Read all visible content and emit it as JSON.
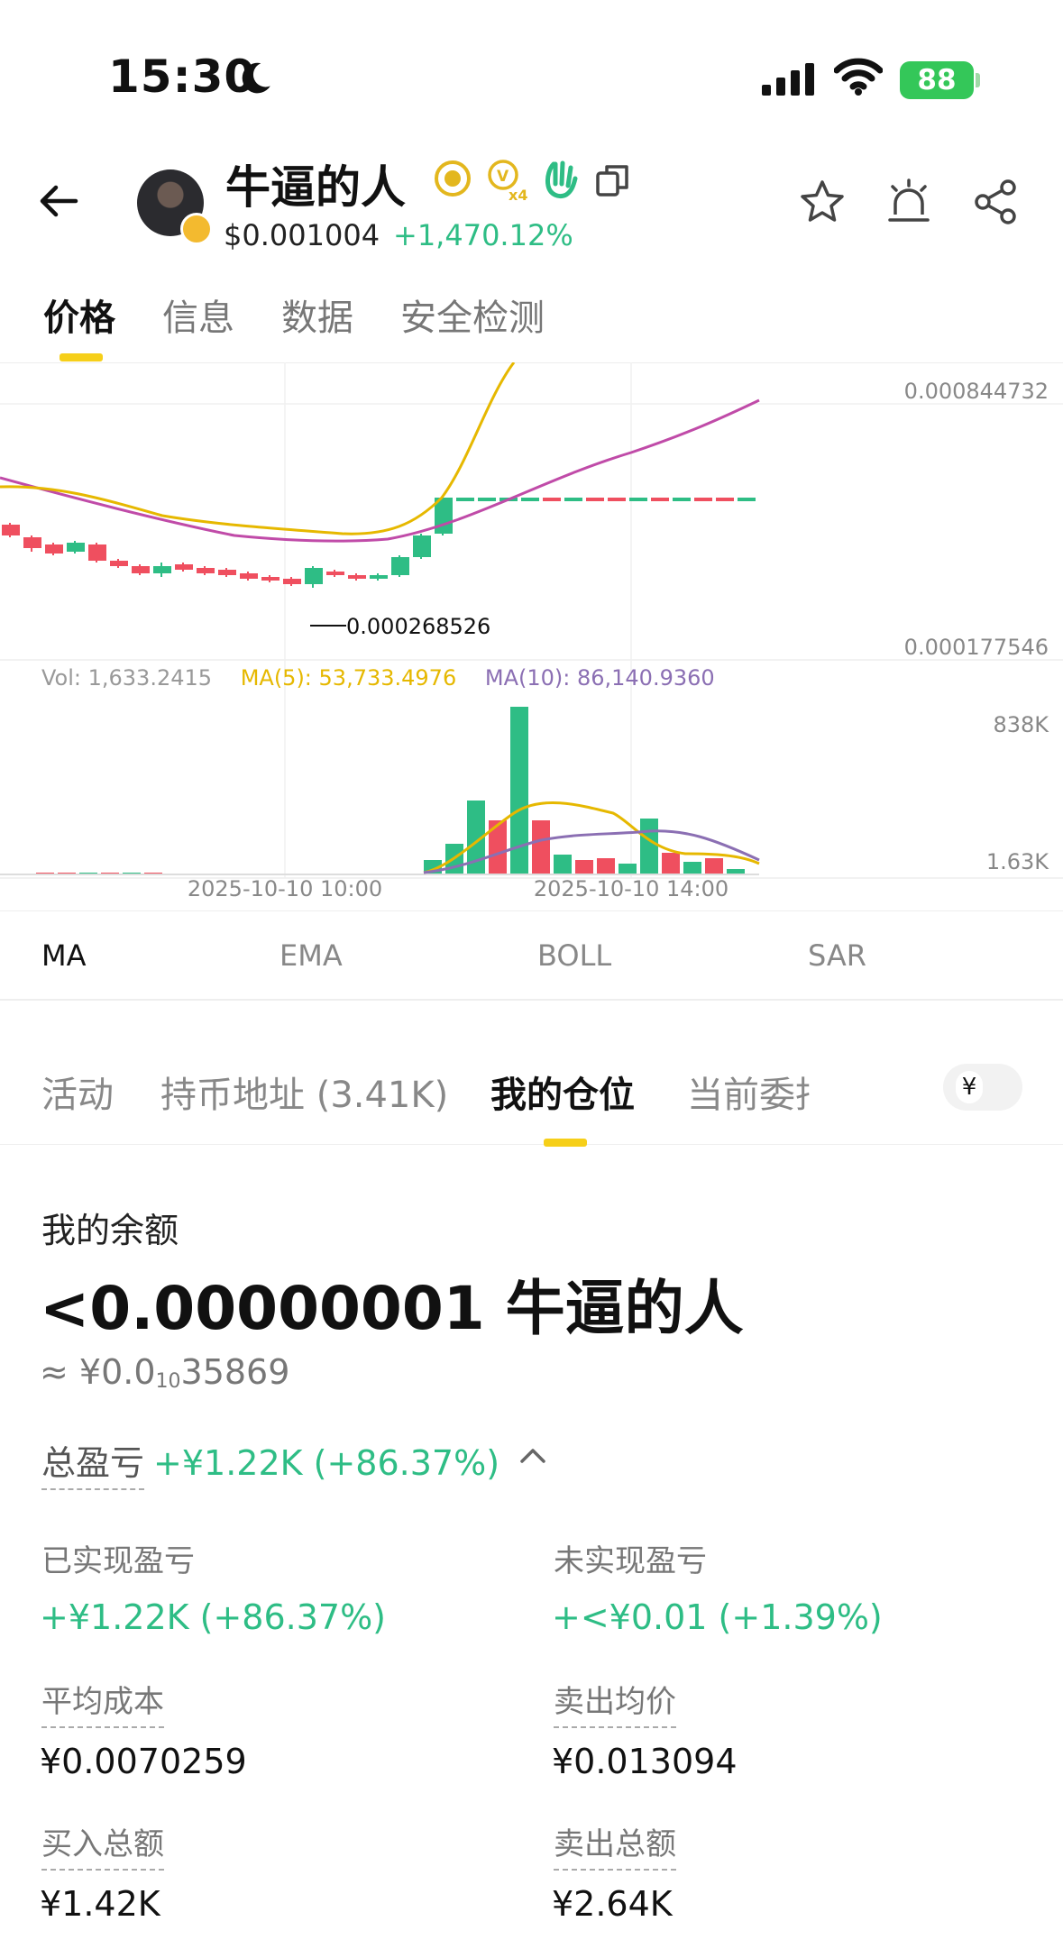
{
  "status_bar": {
    "time": "15:30",
    "battery": "88"
  },
  "header": {
    "token_name": "牛逼的人",
    "price": "$0.001004",
    "change": "+1,470.12%"
  },
  "tabs": [
    "价格",
    "信息",
    "数据",
    "安全检测"
  ],
  "chart": {
    "price_high_label": "0.000844732",
    "price_low_label": "0.000177546",
    "marker_label": "0.000268526",
    "vol_max_label": "838K",
    "vol_min_label": "1.63K",
    "x_labels": [
      "2025-10-10 10:00",
      "2025-10-10 14:00"
    ],
    "legend": {
      "vol": "Vol: 1,633.2415",
      "ma5": "MA(5): 53,733.4976",
      "ma10": "MA(10): 86,140.9360"
    },
    "colors": {
      "up": "#2ebd85",
      "down": "#ef4f5f",
      "ma_yellow": "#e6b800",
      "ma_purple": "#c04ba8",
      "vol_purple": "#8b6fb3"
    }
  },
  "indicators": [
    "MA",
    "EMA",
    "BOLL",
    "SAR"
  ],
  "subtabs": [
    "活动",
    "持币地址 (3.41K)",
    "我的仓位",
    "当前委托"
  ],
  "currency_symbol": "¥",
  "position": {
    "balance_label": "我的余额",
    "balance": "<0.00000001 牛逼的人",
    "balance_cny_prefix": "≈ ¥0.0",
    "balance_cny_sub": "10",
    "balance_cny_suffix": "35869",
    "total_pnl_label": "总盈亏",
    "total_pnl_value": "+¥1.22K (+86.37%)",
    "realized_label": "已实现盈亏",
    "realized_value": "+¥1.22K (+86.37%)",
    "unrealized_label": "未实现盈亏",
    "unrealized_value": "+<¥0.01 (+1.39%)",
    "avg_cost_label": "平均成本",
    "avg_cost_value": "¥0.0070259",
    "avg_sell_label": "卖出均价",
    "avg_sell_value": "¥0.013094",
    "buy_total_label": "买入总额",
    "buy_total_value": "¥1.42K",
    "sell_total_label": "卖出总额",
    "sell_total_value": "¥2.64K"
  }
}
